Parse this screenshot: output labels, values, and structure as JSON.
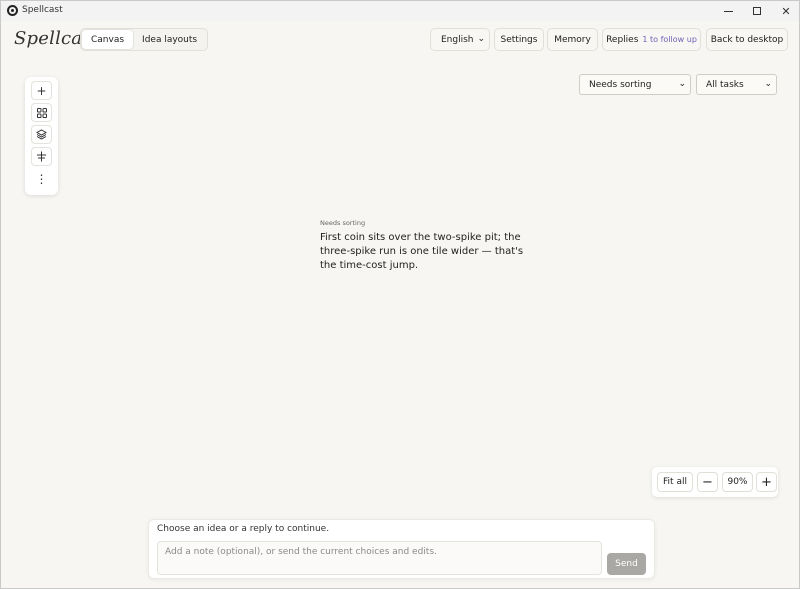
{
  "window": {
    "title": "Spellcast",
    "minimize_icon": "minimize-icon",
    "maximize_icon": "maximize-icon",
    "close_glyph": "✕"
  },
  "header": {
    "brand": "Spellcast",
    "tabs": [
      {
        "label": "Canvas",
        "active": true
      },
      {
        "label": "Idea layouts",
        "active": false
      }
    ],
    "language": "English",
    "settings_label": "Settings",
    "memory_label": "Memory",
    "replies_label": "Replies",
    "replies_sub": "1 to follow up",
    "back_label": "Back to desktop"
  },
  "palette": {
    "tools": [
      {
        "icon": "plus-icon",
        "glyph": "+"
      },
      {
        "icon": "grid-icon",
        "glyph": "⊞"
      },
      {
        "icon": "layers-icon",
        "glyph": "◈"
      },
      {
        "icon": "align-icon",
        "glyph": "⇳"
      },
      {
        "icon": "more-vertical-icon",
        "glyph": "⋮"
      }
    ]
  },
  "filters": {
    "sort_value": "Needs sorting",
    "tasks_value": "All tasks"
  },
  "idea": {
    "tag": "Needs sorting",
    "text": "First coin sits over the two-spike pit; the three-spike run is one tile wider — that's the time-cost jump."
  },
  "zoom": {
    "fit_label": "Fit all",
    "minus": "−",
    "level": "90%",
    "plus": "+"
  },
  "composer": {
    "prompt": "Choose an idea or a reply to continue.",
    "placeholder": "Add a note (optional), or send the current choices and edits.",
    "send_label": "Send"
  }
}
